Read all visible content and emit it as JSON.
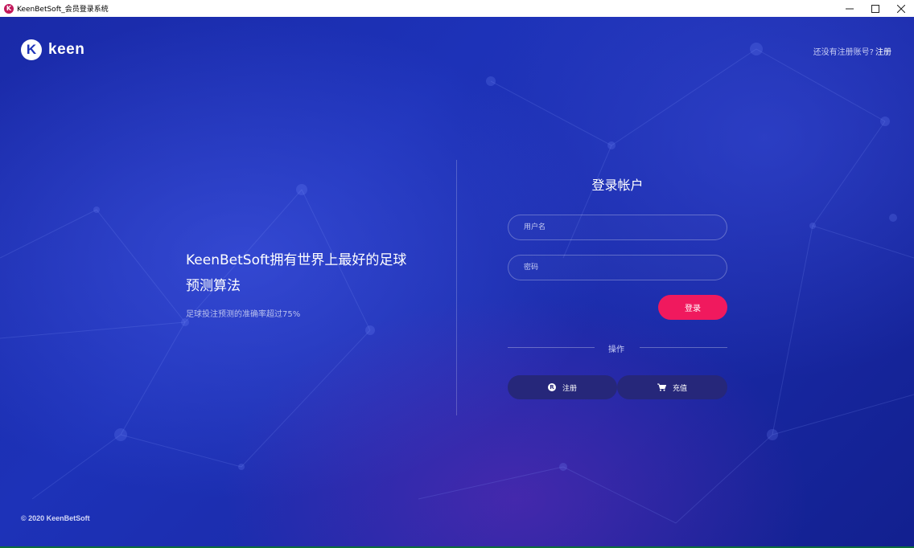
{
  "window": {
    "title": "KeenBetSoft_会员登录系统",
    "icon_letter": "K",
    "controls": {
      "minimize": "—",
      "maximize": "☐",
      "close": "✕"
    }
  },
  "brand": {
    "logo_letter": "K",
    "name": "keen"
  },
  "header": {
    "prompt": "还没有注册账号?",
    "register_link": "注册"
  },
  "hero": {
    "headline": "KeenBetSoft拥有世界上最好的足球预测算法",
    "subline": "足球投注预测的准确率超过75%"
  },
  "login_form": {
    "title": "登录帐户",
    "username_placeholder": "用户名",
    "password_placeholder": "密码",
    "submit_label": "登录",
    "separator_label": "操作",
    "register_button": "注册",
    "register_icon": "R",
    "recharge_button": "充值"
  },
  "footer": {
    "copyright": "© 2020 KeenBetSoft"
  },
  "colors": {
    "background": "#1d32b8",
    "accent": "#f0195e",
    "action_button": "#26277a"
  }
}
